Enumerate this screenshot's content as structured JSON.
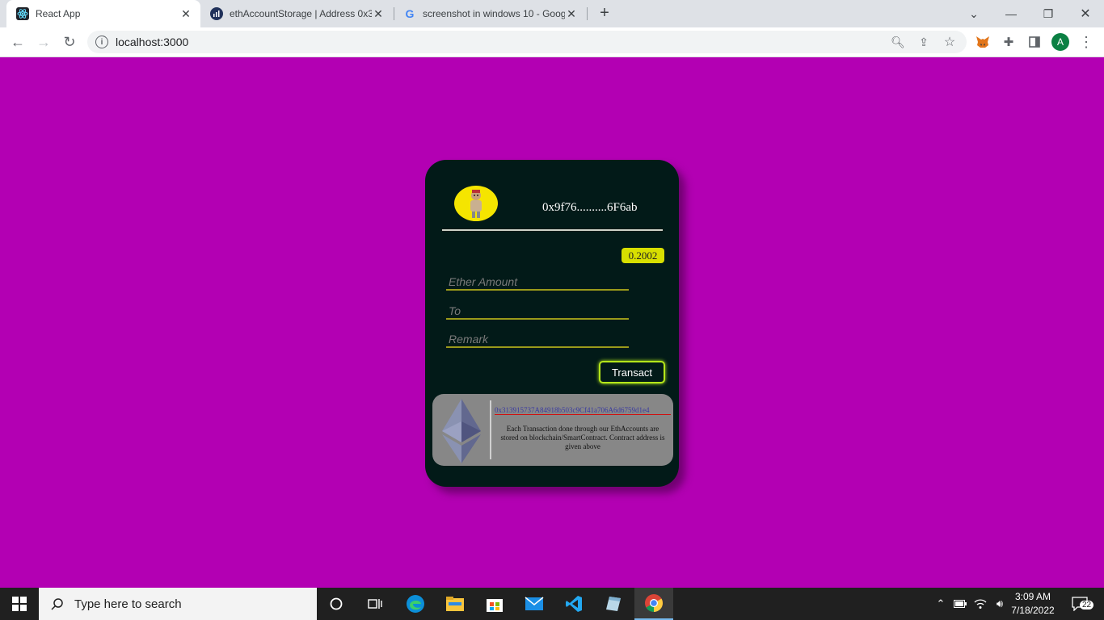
{
  "browser": {
    "tabs": [
      {
        "title": "React App",
        "active": true
      },
      {
        "title": "ethAccountStorage | Address 0x3",
        "active": false
      },
      {
        "title": "screenshot in windows 10 - Goog",
        "active": false
      }
    ],
    "url": "localhost:3000"
  },
  "app": {
    "background": "#b300b3",
    "account_address": "0x9f76..........6F6ab",
    "balance": "0.2002",
    "inputs": {
      "ether_amount_placeholder": "Ether Amount",
      "to_placeholder": "To",
      "remark_placeholder": "Remark"
    },
    "transact_label": "Transact",
    "contract_address": "0x313915737A84918b503c9Cf41a706A6d6759d1e4",
    "note": "Each Transaction done through our EthAccounts are stored on blockchain/SmartContract. Contract address is given above"
  },
  "taskbar": {
    "search_placeholder": "Type here to search",
    "time": "3:09 AM",
    "date": "7/18/2022",
    "notification_count": "22"
  }
}
